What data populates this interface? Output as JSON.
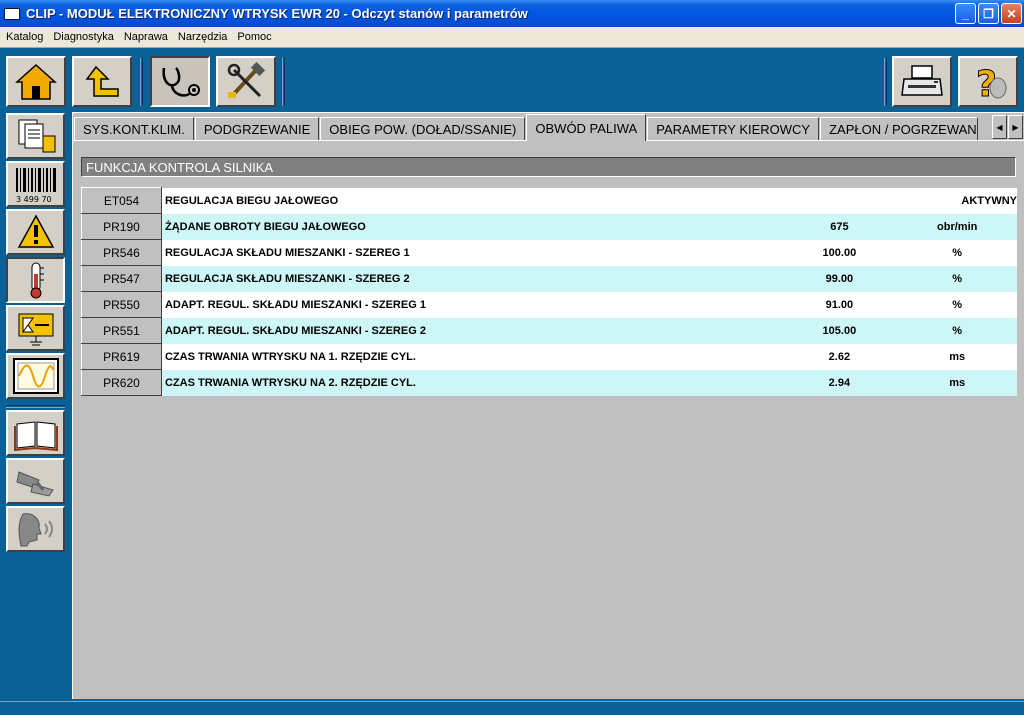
{
  "window": {
    "title": "CLIP - MODUŁ ELEKTRONICZNY WTRYSK EWR 20 - Odczyt stanów i parametrów"
  },
  "menu": [
    "Katalog",
    "Diagnostyka",
    "Naprawa",
    "Narzędzia",
    "Pomoc"
  ],
  "toolbar": {
    "top": [
      "home-icon",
      "back-up-icon",
      "stethoscope-icon",
      "tools-icon",
      "printer-icon",
      "help-icon"
    ],
    "left": [
      "documents-icon",
      "barcode-icon",
      "warning-icon",
      "thermometer-icon",
      "actuator-icon",
      "oscilloscope-icon",
      "book-icon",
      "car-lift-icon",
      "speaker-icon"
    ],
    "barcode_text": "3 499 70"
  },
  "tabs": [
    {
      "label": "SYS.KONT.KLIM.",
      "active": false
    },
    {
      "label": "PODGRZEWANIE",
      "active": false
    },
    {
      "label": "OBIEG POW. (DOŁAD/SSANIE)",
      "active": false
    },
    {
      "label": "OBWÓD PALIWA",
      "active": true
    },
    {
      "label": "PARAMETRY KIEROWCY",
      "active": false
    },
    {
      "label": "ZAPŁON / POGRZEWAN",
      "active": false
    }
  ],
  "section": {
    "title": "FUNKCJA KONTROLA SILNIKA"
  },
  "rows": [
    {
      "code": "ET054",
      "label": "REGULACJA BIEGU JAŁOWEGO",
      "value": "AKTYWNY",
      "unit": ""
    },
    {
      "code": "PR190",
      "label": "ŻĄDANE OBROTY BIEGU JAŁOWEGO",
      "value": "675",
      "unit": "obr/min"
    },
    {
      "code": "PR546",
      "label": "REGULACJA SKŁADU MIESZANKI - SZEREG 1",
      "value": "100.00",
      "unit": "%"
    },
    {
      "code": "PR547",
      "label": "REGULACJA SKŁADU MIESZANKI - SZEREG 2",
      "value": "99.00",
      "unit": "%"
    },
    {
      "code": "PR550",
      "label": "ADAPT. REGUL. SKŁADU MIESZANKI - SZEREG 1",
      "value": "91.00",
      "unit": "%"
    },
    {
      "code": "PR551",
      "label": "ADAPT. REGUL. SKŁADU MIESZANKI - SZEREG 2",
      "value": "105.00",
      "unit": "%"
    },
    {
      "code": "PR619",
      "label": "CZAS TRWANIA WTRYSKU NA 1. RZĘDZIE CYL.",
      "value": "2.62",
      "unit": "ms"
    },
    {
      "code": "PR620",
      "label": "CZAS TRWANIA WTRYSKU NA 2. RZĘDZIE CYL.",
      "value": "2.94",
      "unit": "ms"
    }
  ]
}
